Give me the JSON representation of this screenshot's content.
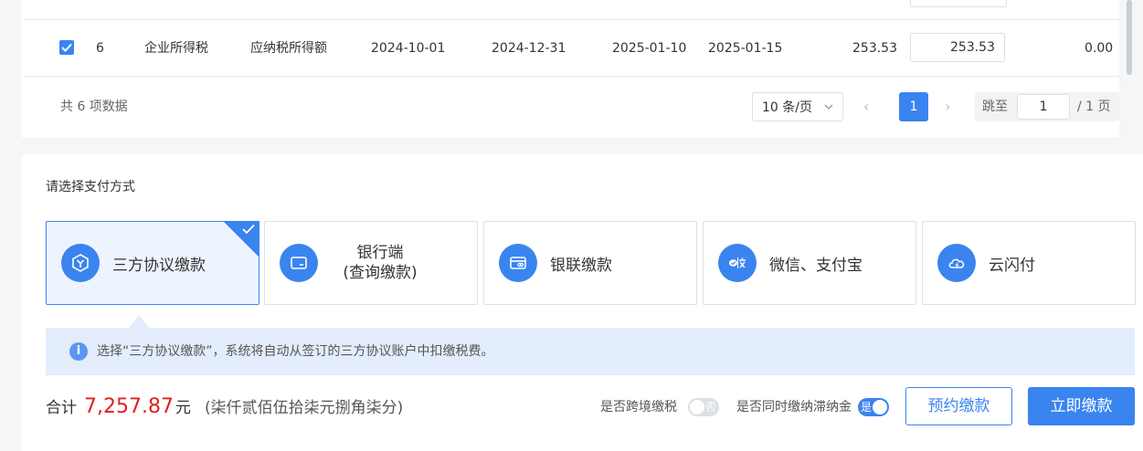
{
  "table": {
    "row": {
      "checked": true,
      "index": "6",
      "tax_type": "企业所得税",
      "tax_item": "应纳税所得额",
      "period_start": "2024-10-01",
      "period_end": "2024-12-31",
      "declare_date": "2025-01-10",
      "deadline": "2025-01-15",
      "payable": "253.53",
      "pay_amount": "253.53",
      "balance": "0.00"
    },
    "summary": "共 6 项数据"
  },
  "pagination": {
    "page_size": "10 条/页",
    "prev": "‹",
    "current_page": "1",
    "next": "›",
    "jump_label": "跳至",
    "jump_value": "1",
    "total_pages": "/ 1 页"
  },
  "payment": {
    "title": "请选择支付方式",
    "methods": [
      {
        "label": "三方协议缴款",
        "icon": "hexagon-y-icon",
        "selected": true
      },
      {
        "label_line1": "银行端",
        "label_line2": "(查询缴款)",
        "icon": "card-icon"
      },
      {
        "label": "银联缴款",
        "icon": "unionpay-card-icon"
      },
      {
        "label": "微信、支付宝",
        "icon": "wechat-alipay-icon"
      },
      {
        "label": "云闪付",
        "icon": "cloud-pay-icon"
      }
    ],
    "info": "选择“三方协议缴款”，系统将自动从签订的三方协议账户中扣缴税费。"
  },
  "footer": {
    "total_label": "合计",
    "total_amount": "7,257.87",
    "unit": "元",
    "amount_chinese": "(柒仟贰佰伍拾柒元捌角柒分)",
    "cross_border_label": "是否跨境缴税",
    "cross_border_toggle": "否",
    "late_fee_label": "是否同时缴纳滞纳金",
    "late_fee_toggle": "是",
    "reserve_button": "预约缴款",
    "pay_button": "立即缴款"
  },
  "colors": {
    "primary": "#3a84f0",
    "amount_red": "#e02020",
    "info_bg": "#e3edfc"
  }
}
